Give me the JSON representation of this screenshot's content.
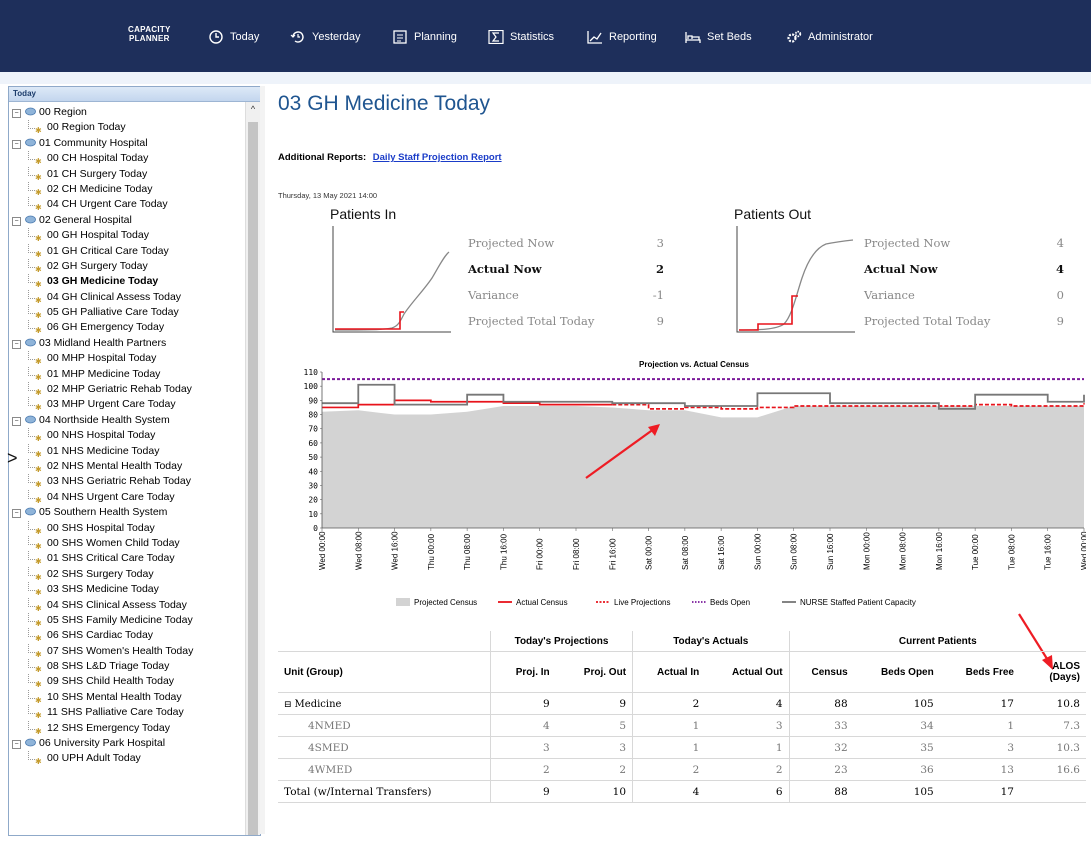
{
  "app": {
    "brand_line1": "CAPACITY",
    "brand_line2": "PLANNER"
  },
  "nav": [
    {
      "label": "Today",
      "icon": "clock-icon"
    },
    {
      "label": "Yesterday",
      "icon": "history-icon"
    },
    {
      "label": "Planning",
      "icon": "planning-icon"
    },
    {
      "label": "Statistics",
      "icon": "sigma-icon"
    },
    {
      "label": "Reporting",
      "icon": "chart-icon"
    },
    {
      "label": "Set Beds",
      "icon": "bed-icon"
    },
    {
      "label": "Administrator",
      "icon": "gears-icon"
    }
  ],
  "sidebar": {
    "header": "Today",
    "tree": [
      {
        "type": "group",
        "label": "00 Region"
      },
      {
        "type": "item",
        "label": "00 Region Today"
      },
      {
        "type": "group",
        "label": "01 Community Hospital"
      },
      {
        "type": "item",
        "label": "00 CH Hospital Today"
      },
      {
        "type": "item",
        "label": "01 CH Surgery Today"
      },
      {
        "type": "item",
        "label": "02 CH Medicine Today"
      },
      {
        "type": "item",
        "label": "04 CH Urgent Care Today"
      },
      {
        "type": "group",
        "label": "02 General Hospital"
      },
      {
        "type": "item",
        "label": "00 GH Hospital Today"
      },
      {
        "type": "item",
        "label": "01 GH Critical Care Today"
      },
      {
        "type": "item",
        "label": "02 GH Surgery Today"
      },
      {
        "type": "item",
        "label": "03 GH Medicine Today",
        "selected": true
      },
      {
        "type": "item",
        "label": "04 GH Clinical Assess Today"
      },
      {
        "type": "item",
        "label": "05 GH Palliative Care Today"
      },
      {
        "type": "item",
        "label": "06 GH Emergency Today"
      },
      {
        "type": "group",
        "label": "03 Midland Health Partners"
      },
      {
        "type": "item",
        "label": "00 MHP Hospital Today"
      },
      {
        "type": "item",
        "label": "01 MHP Medicine Today"
      },
      {
        "type": "item",
        "label": "02 MHP Geriatric Rehab Today"
      },
      {
        "type": "item",
        "label": "03 MHP Urgent Care Today"
      },
      {
        "type": "group",
        "label": "04 Northside Health System"
      },
      {
        "type": "item",
        "label": "00 NHS Hospital Today"
      },
      {
        "type": "item",
        "label": "01 NHS Medicine Today"
      },
      {
        "type": "item",
        "label": "02 NHS Mental Health Today"
      },
      {
        "type": "item",
        "label": "03 NHS Geriatric Rehab Today"
      },
      {
        "type": "item",
        "label": "04 NHS Urgent Care Today"
      },
      {
        "type": "group",
        "label": "05 Southern Health System"
      },
      {
        "type": "item",
        "label": "00 SHS Hospital Today"
      },
      {
        "type": "item",
        "label": "00 SHS Women Child Today"
      },
      {
        "type": "item",
        "label": "01 SHS Critical Care Today"
      },
      {
        "type": "item",
        "label": "02 SHS Surgery Today"
      },
      {
        "type": "item",
        "label": "03 SHS Medicine Today"
      },
      {
        "type": "item",
        "label": "04 SHS Clinical Assess Today"
      },
      {
        "type": "item",
        "label": "05 SHS Family Medicine Today"
      },
      {
        "type": "item",
        "label": "06 SHS Cardiac Today"
      },
      {
        "type": "item",
        "label": "07 SHS Women's Health Today"
      },
      {
        "type": "item",
        "label": "08 SHS L&D Triage Today"
      },
      {
        "type": "item",
        "label": "09 SHS Child Health Today"
      },
      {
        "type": "item",
        "label": "10 SHS Mental Health Today"
      },
      {
        "type": "item",
        "label": "11 SHS Palliative Care Today"
      },
      {
        "type": "item",
        "label": "12 SHS Emergency Today"
      },
      {
        "type": "group",
        "label": "06 University Park Hospital"
      },
      {
        "type": "item",
        "label": "00 UPH Adult Today"
      }
    ]
  },
  "page": {
    "title": "03 GH Medicine Today",
    "additional_label": "Additional Reports:",
    "additional_link": "Daily Staff Projection Report",
    "timestamp": "Thursday, 13 May 2021 14:00"
  },
  "patients_in": {
    "title": "Patients In",
    "rows": [
      {
        "label": "Projected Now",
        "value": "3",
        "bold": false
      },
      {
        "label": "Actual Now",
        "value": "2",
        "bold": true
      },
      {
        "label": "Variance",
        "value": "-1",
        "bold": false
      },
      {
        "label": "Projected Total Today",
        "value": "9",
        "bold": false
      }
    ]
  },
  "patients_out": {
    "title": "Patients Out",
    "rows": [
      {
        "label": "Projected Now",
        "value": "4",
        "bold": false
      },
      {
        "label": "Actual Now",
        "value": "4",
        "bold": true
      },
      {
        "label": "Variance",
        "value": "0",
        "bold": false
      },
      {
        "label": "Projected Total Today",
        "value": "9",
        "bold": false
      }
    ]
  },
  "chart_data": {
    "type": "area",
    "title": "Projection vs. Actual Census",
    "ylim": [
      0,
      110
    ],
    "yticks": [
      0,
      10,
      20,
      30,
      40,
      50,
      60,
      70,
      80,
      90,
      100,
      110
    ],
    "x": [
      "Wed 00:00",
      "Wed 08:00",
      "Wed 16:00",
      "Thu 00:00",
      "Thu 08:00",
      "Thu 16:00",
      "Fri 00:00",
      "Fri 08:00",
      "Fri 16:00",
      "Sat 00:00",
      "Sat 08:00",
      "Sat 16:00",
      "Sun 00:00",
      "Sun 08:00",
      "Sun 16:00",
      "Mon 00:00",
      "Mon 08:00",
      "Mon 16:00",
      "Tue 00:00",
      "Tue 08:00",
      "Tue 16:00",
      "Wed 00:00"
    ],
    "series": [
      {
        "name": "Projected Census",
        "style": "area",
        "color": "#d3d3d3",
        "values": [
          82,
          83,
          80,
          80,
          82,
          86,
          86,
          86,
          85,
          83,
          83,
          78,
          78,
          86,
          86,
          86,
          86,
          86,
          86,
          86,
          86,
          86
        ]
      },
      {
        "name": "Actual Census",
        "style": "line",
        "color": "#e8131b",
        "values": [
          85,
          87,
          90,
          89,
          89,
          88,
          87,
          87,
          87,
          null,
          null,
          null,
          null,
          null,
          null,
          null,
          null,
          null,
          null,
          null,
          null,
          null
        ]
      },
      {
        "name": "Live Projections",
        "style": "dashed",
        "color": "#e8131b",
        "values": [
          null,
          null,
          null,
          null,
          null,
          null,
          null,
          null,
          87,
          84,
          85,
          84,
          85,
          86,
          86,
          86,
          86,
          86,
          87,
          86,
          86,
          88
        ]
      },
      {
        "name": "Beds Open",
        "style": "dotted",
        "color": "#7a1a9a",
        "values": [
          105,
          105,
          105,
          105,
          105,
          105,
          105,
          105,
          105,
          105,
          105,
          105,
          105,
          105,
          105,
          105,
          105,
          105,
          105,
          105,
          105,
          105
        ]
      },
      {
        "name": "NURSE Staffed Patient Capacity",
        "style": "line",
        "color": "#777777",
        "values": [
          88,
          101,
          87,
          87,
          94,
          89,
          89,
          89,
          88,
          88,
          86,
          86,
          95,
          95,
          88,
          88,
          88,
          84,
          94,
          94,
          89,
          94
        ]
      }
    ]
  },
  "table": {
    "group_headers": [
      "Today's Projections",
      "Today's Actuals",
      "Current Patients"
    ],
    "columns": [
      "Unit (Group)",
      "Proj. In",
      "Proj. Out",
      "Actual In",
      "Actual Out",
      "Census",
      "Beds Open",
      "Beds Free",
      "ALOS (Days)"
    ],
    "rows": [
      {
        "kind": "group",
        "expander": "⊟",
        "cells": [
          "Medicine",
          "9",
          "9",
          "2",
          "4",
          "88",
          "105",
          "17",
          "10.8"
        ]
      },
      {
        "kind": "sub",
        "cells": [
          "4NMED",
          "4",
          "5",
          "1",
          "3",
          "33",
          "34",
          "1",
          "7.3"
        ]
      },
      {
        "kind": "sub",
        "cells": [
          "4SMED",
          "3",
          "3",
          "1",
          "1",
          "32",
          "35",
          "3",
          "10.3"
        ]
      },
      {
        "kind": "sub",
        "cells": [
          "4WMED",
          "2",
          "2",
          "2",
          "2",
          "23",
          "36",
          "13",
          "16.6"
        ]
      },
      {
        "kind": "total",
        "cells": [
          "Total (w/Internal Transfers)",
          "9",
          "10",
          "4",
          "6",
          "88",
          "105",
          "17",
          ""
        ]
      }
    ]
  }
}
